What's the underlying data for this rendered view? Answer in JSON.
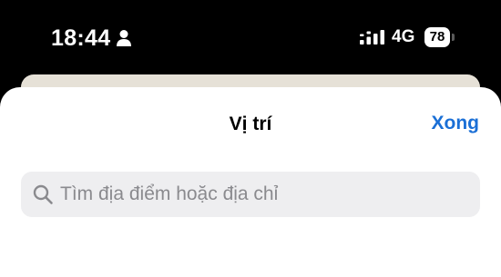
{
  "status_bar": {
    "time": "18:44",
    "network": "4G",
    "battery_level": "78",
    "icons": [
      "person-icon",
      "cellular-signal-icon",
      "battery-icon"
    ]
  },
  "sheet": {
    "title": "Vị trí",
    "done_label": "Xong"
  },
  "search": {
    "placeholder": "Tìm địa điểm hoặc địa chỉ",
    "value": ""
  },
  "colors": {
    "accent": "#1a6fd6",
    "search_background": "#eeeef0",
    "placeholder_text": "#8a8a8e",
    "status_bar_background": "#000000"
  }
}
